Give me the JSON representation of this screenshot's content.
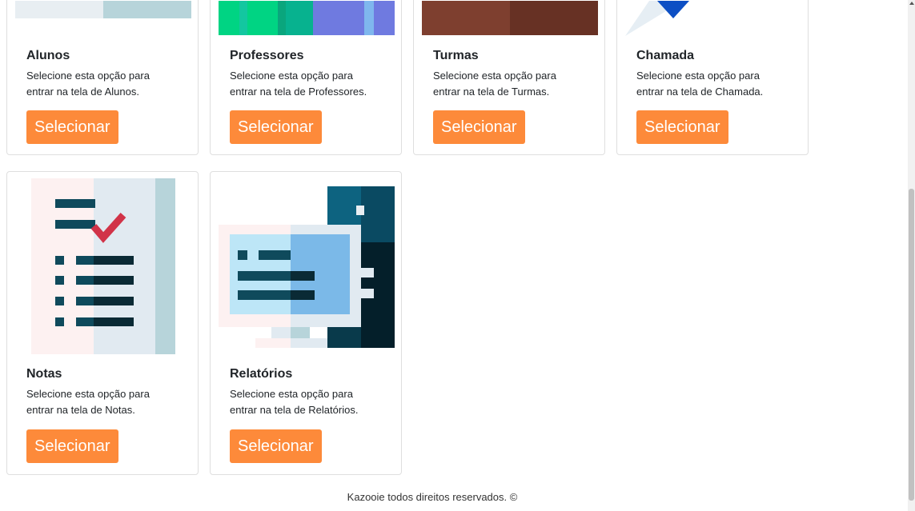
{
  "cards": [
    {
      "title": "Alunos",
      "desc_line1": "Selecione esta opção para",
      "desc_line2": "entrar na tela de Alunos.",
      "button": "Selecionar"
    },
    {
      "title": "Professores",
      "desc_line1": "Selecione esta opção para",
      "desc_line2": "entrar na tela de Professores.",
      "button": "Selecionar"
    },
    {
      "title": "Turmas",
      "desc_line1": "Selecione esta opção para",
      "desc_line2": "entrar na tela de Turmas.",
      "button": "Selecionar"
    },
    {
      "title": "Chamada",
      "desc_line1": "Selecione esta opção para",
      "desc_line2": "entrar na tela de Chamada.",
      "button": "Selecionar"
    },
    {
      "title": "Notas",
      "desc_line1": "Selecione esta opção para",
      "desc_line2": "entrar na tela de Notas.",
      "button": "Selecionar"
    },
    {
      "title": "Relatórios",
      "desc_line1": "Selecione esta opção para",
      "desc_line2": "entrar na tela de Relatórios.",
      "button": "Selecionar"
    }
  ],
  "footer": {
    "text": "Kazooie todos direitos reservados. ©"
  },
  "colors": {
    "button": "#fd8a3a",
    "card_border": "#dfdfdf"
  },
  "icons": [
    "students-illustration",
    "teachers-illustration",
    "classes-illustration",
    "attendance-illustration",
    "grades-illustration",
    "reports-illustration"
  ]
}
